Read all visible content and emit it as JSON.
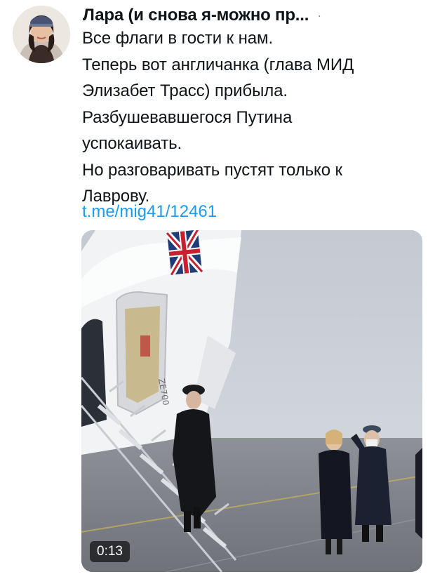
{
  "tweet": {
    "author_name": "Лара (и снова я-можно пр...",
    "separator": "·",
    "text_lines": [
      "Все флаги в гости к нам.",
      "Теперь вот англичанка (глава МИД",
      "Элизабет Трасс) прибыла.",
      "Разбушевавшегося Путина",
      "успокаивать.",
      "Но разговаривать пустят только к",
      "Лаврову."
    ],
    "link_text": "t.me/mig41/12461"
  },
  "media": {
    "type": "video",
    "duration": "0:13",
    "aircraft_reg": "ZE700"
  }
}
